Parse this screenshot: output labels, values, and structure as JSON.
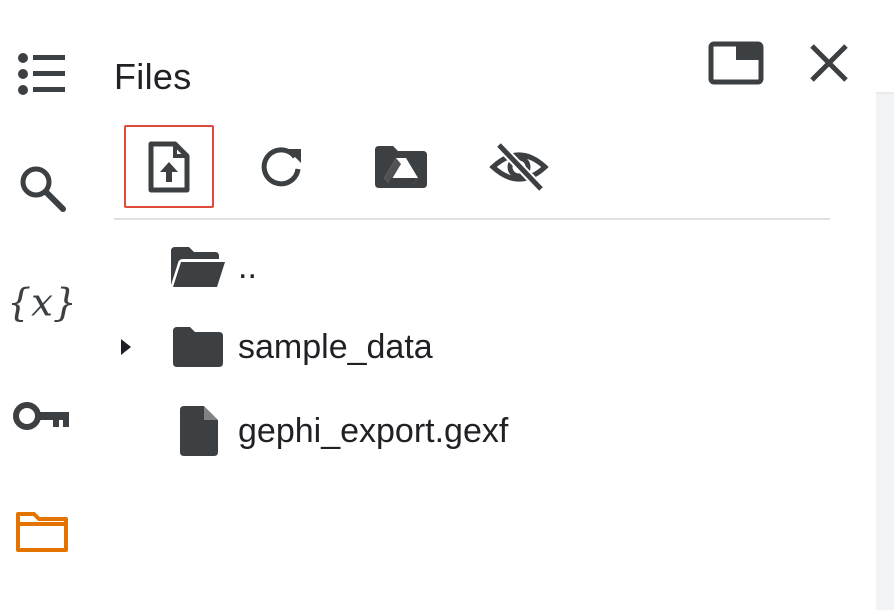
{
  "panel": {
    "title": "Files"
  },
  "left_rail": {
    "items": [
      {
        "name": "table-of-contents",
        "icon": "list-icon",
        "active": false
      },
      {
        "name": "find-and-replace",
        "icon": "search-icon",
        "active": false
      },
      {
        "name": "variables",
        "icon": "variables-icon",
        "active": false
      },
      {
        "name": "secrets",
        "icon": "key-icon",
        "active": false
      },
      {
        "name": "files",
        "icon": "folder-icon",
        "active": true
      }
    ]
  },
  "header_actions": {
    "items": [
      {
        "name": "open-in-tab",
        "icon": "window-icon"
      },
      {
        "name": "close",
        "icon": "close-icon"
      }
    ]
  },
  "toolbar": {
    "items": [
      {
        "name": "upload",
        "icon": "upload-file-icon",
        "highlighted": true
      },
      {
        "name": "refresh",
        "icon": "refresh-icon",
        "highlighted": false
      },
      {
        "name": "mount-drive",
        "icon": "drive-folder-icon",
        "highlighted": false
      },
      {
        "name": "toggle-hidden",
        "icon": "eye-off-icon",
        "highlighted": false
      }
    ]
  },
  "files": [
    {
      "name": "..",
      "type": "parent-folder",
      "icon": "folder-open-icon",
      "expandable": false
    },
    {
      "name": "sample_data",
      "type": "folder",
      "icon": "folder-icon",
      "expandable": true
    },
    {
      "name": "gephi_export.gexf",
      "type": "file",
      "icon": "file-icon",
      "expandable": false
    }
  ],
  "colors": {
    "icon": "#3c4043",
    "active_rail": "#e37400",
    "highlight_border": "#e14b3c",
    "divider": "#e0e0e0"
  }
}
